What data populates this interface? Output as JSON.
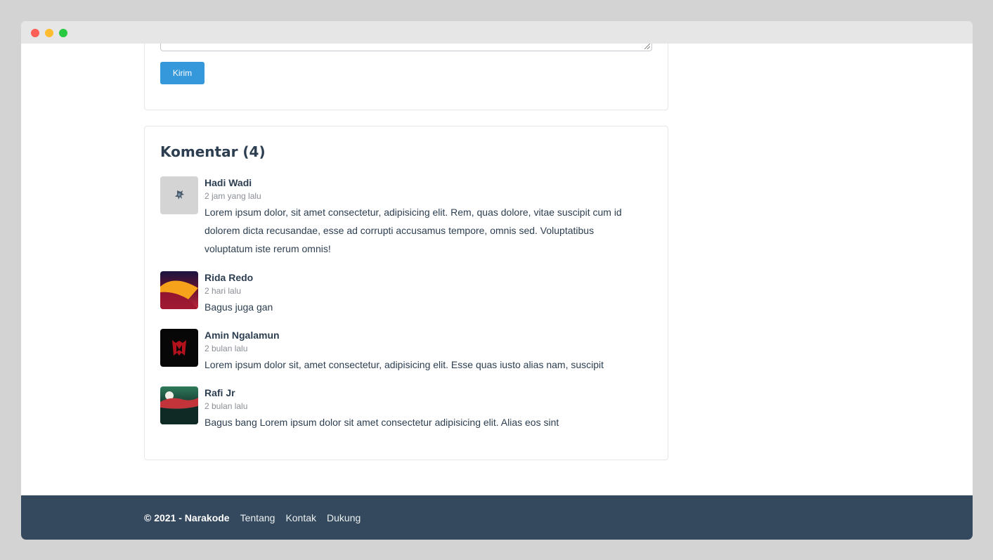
{
  "form": {
    "submit_label": "Kirim"
  },
  "comments": {
    "title": "Komentar (4)",
    "items": [
      {
        "author": "Hadi Wadi",
        "time": "2 jam yang lalu",
        "text": "Lorem ipsum dolor, sit amet consectetur, adipisicing elit. Rem, quas dolore, vitae suscipit cum id dolorem dicta recusandae, esse ad corrupti accusamus tempore, omnis sed. Voluptatibus voluptatum iste rerum omnis!"
      },
      {
        "author": "Rida Redo",
        "time": "2 hari lalu",
        "text": "Bagus juga gan"
      },
      {
        "author": "Amin Ngalamun",
        "time": "2 bulan lalu",
        "text": "Lorem ipsum dolor sit, amet consectetur, adipisicing elit. Esse quas iusto alias nam, suscipit"
      },
      {
        "author": "Rafi Jr",
        "time": "2 bulan lalu",
        "text": "Bagus bang Lorem ipsum dolor sit amet consectetur adipisicing elit. Alias eos sint"
      }
    ]
  },
  "footer": {
    "copyright": "© 2021 - Narakode",
    "links": [
      "Tentang",
      "Kontak",
      "Dukung"
    ]
  },
  "colors": {
    "accent": "#3498db",
    "footer_bg": "#34495e",
    "text_dark": "#2c3e50",
    "text_muted": "#8a8f96"
  }
}
